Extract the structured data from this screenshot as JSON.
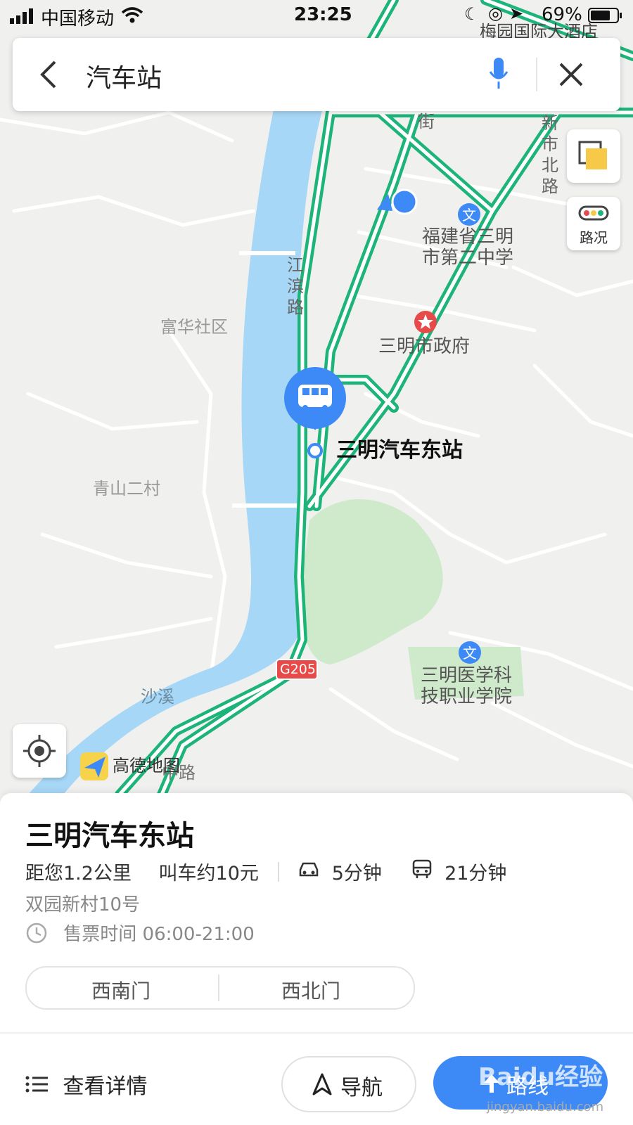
{
  "status_bar": {
    "carrier": "中国移动",
    "time": "23:25",
    "battery": "69%"
  },
  "search": {
    "query": "汽车站"
  },
  "map": {
    "top_label": "梅园国际大酒店",
    "roads": {
      "jiangbin": "江滨路",
      "street": "街",
      "xinshi": "新市北路",
      "zhonghua": "中路"
    },
    "pois": {
      "school": "福建省三明\n市第二中学",
      "gov": "三明市政府",
      "station": "三明汽车东站",
      "college": "三明医学科\n技职业学院"
    },
    "areas": {
      "fuhua": "富华社区",
      "qingshan": "青山二村"
    },
    "river": "沙溪",
    "highway_badge": "G205",
    "traffic_label": "路况",
    "brand": "高德地图"
  },
  "place": {
    "title": "三明汽车东站",
    "distance": "距您1.2公里",
    "taxi": "叫车约10元",
    "drive_time": "5分钟",
    "bus_time": "21分钟",
    "address": "双园新村10号",
    "hours": "售票时间 06:00-21:00",
    "gates": [
      "西南门",
      "西北门"
    ]
  },
  "actions": {
    "details": "查看详情",
    "navigate": "导航",
    "route": "路线"
  },
  "watermark": {
    "text": "Baidu经验",
    "sub": "jingyan.baidu.com"
  },
  "colors": {
    "road": "#1db47a",
    "water": "#a7d7f6",
    "green": "#cfeacb",
    "accent": "#3d8af7"
  }
}
